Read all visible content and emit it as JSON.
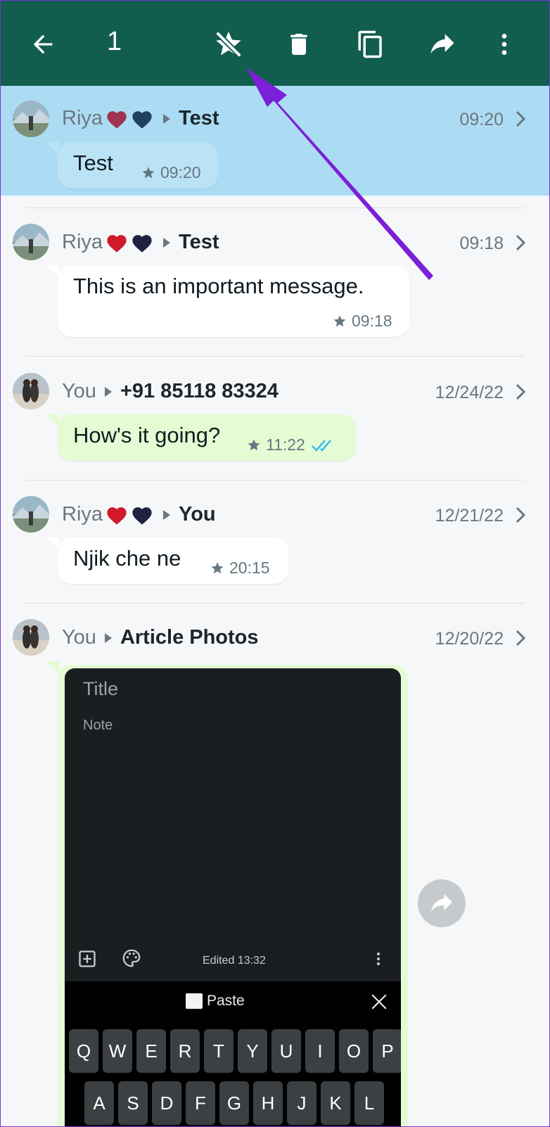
{
  "toolbar": {
    "selected_count": "1",
    "icons": [
      "back-arrow-icon",
      "unstar-icon",
      "delete-icon",
      "copy-icon",
      "forward-icon",
      "more-vert-icon"
    ]
  },
  "messages": [
    {
      "sender": "Riya",
      "recipient": "Test",
      "time": "09:20",
      "text": "Test",
      "meta_time": "09:20",
      "selected": true
    },
    {
      "sender": "Riya",
      "recipient": "Test",
      "time": "09:18",
      "text": "This is an important message.",
      "meta_time": "09:18"
    },
    {
      "sender": "You",
      "recipient": "+91 85118 83324",
      "time": "12/24/22",
      "text": "How's it going?",
      "meta_time": "11:22"
    },
    {
      "sender": "Riya",
      "recipient": "You",
      "time": "12/21/22",
      "text": "Njik che ne",
      "meta_time": "20:15"
    },
    {
      "sender": "You",
      "recipient": "Article Photos",
      "time": "12/20/22"
    }
  ],
  "image_message": {
    "title": "Title",
    "note": "Note",
    "edited": "Edited 13:32",
    "paste": "Paste",
    "keys_row1": [
      "Q",
      "W",
      "E",
      "R",
      "T",
      "Y",
      "U",
      "I",
      "O",
      "P"
    ],
    "keys_row2": [
      "A",
      "S",
      "D",
      "F",
      "G",
      "H",
      "J",
      "K",
      "L"
    ]
  },
  "colors": {
    "toolbar": "#115e4e",
    "selected": "#acdcf3",
    "outgoing_bubble": "#e4fbd3",
    "annotation_arrow": "#7b1fd8",
    "read_ticks": "#34b7f1"
  }
}
